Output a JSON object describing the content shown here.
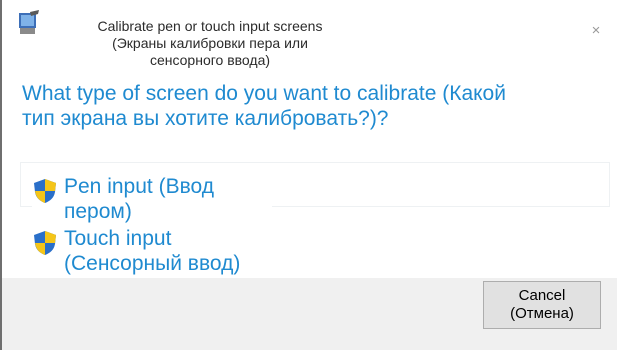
{
  "window": {
    "title": "Calibrate pen or touch input screens\n(Экраны калибровки пера или\nсенсорного ввода)",
    "close_glyph": "×",
    "app_icon": "calibration-icon"
  },
  "main": {
    "heading": "What type of screen do you want to calibrate (Какой\nтип экрана вы хотите калибровать?)?",
    "options": [
      {
        "label": "Pen input (Ввод\nпером)",
        "icon": "uac-shield-icon"
      },
      {
        "label": "Touch input\n(Сенсорный ввод)",
        "icon": "uac-shield-icon"
      }
    ]
  },
  "footer": {
    "cancel_label": "Cancel\n(Отмена)"
  },
  "colors": {
    "link_blue": "#1f8ad0",
    "footer_bg": "#f0f0f0",
    "button_bg": "#e1e1e1",
    "shield_blue": "#2a6fc9",
    "shield_yellow": "#f5c518"
  }
}
